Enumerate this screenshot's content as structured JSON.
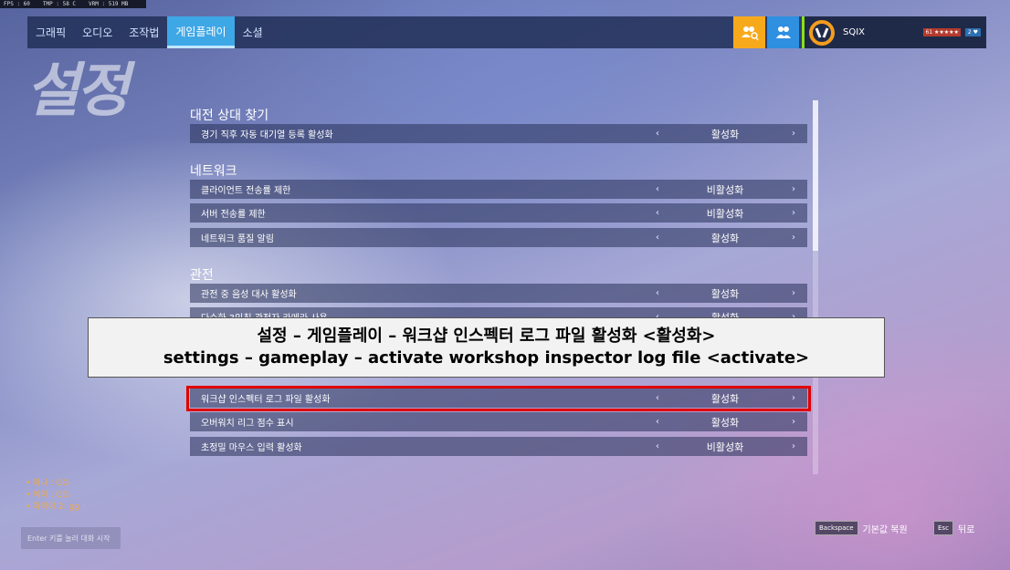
{
  "perf": {
    "fps": "FPS : 60",
    "tmp": "TMP : 58 C",
    "vram": "VRM : 519 MB"
  },
  "tabs": [
    {
      "label": "그래픽"
    },
    {
      "label": "오디오"
    },
    {
      "label": "조작법"
    },
    {
      "label": "게임플레이",
      "active": true
    },
    {
      "label": "소셜"
    }
  ],
  "profile": {
    "name": "SQIX",
    "level": "61 ★★★★★",
    "endorsement": "2 ♥"
  },
  "page_title": "설정",
  "sections": [
    {
      "heading": "대전 상대 찾기",
      "rows": [
        {
          "label": "경기 직후 자동 대기열 등록 활성화",
          "value": "활성화"
        }
      ]
    },
    {
      "heading": "네트워크",
      "rows": [
        {
          "label": "클라이언트 전송률 제한",
          "value": "비활성화"
        },
        {
          "label": "서버 전송률 제한",
          "value": "비활성화"
        },
        {
          "label": "네트워크 품질 알림",
          "value": "활성화"
        }
      ]
    },
    {
      "heading": "관전",
      "rows": [
        {
          "label": "관전 중 음성 대사 활성화",
          "value": "활성화"
        },
        {
          "label": "다수화 3인칭 관전자 카메라 사용",
          "value": "활성화"
        }
      ]
    },
    {
      "heading": "",
      "rows": [
        {
          "label": "워크샵 인스펙터 로그 파일 활성화",
          "value": "활성화"
        },
        {
          "label": "오버워치 리그 점수 표시",
          "value": "활성화"
        },
        {
          "label": "초정밀 마우스 입력 활성화",
          "value": "비활성화"
        }
      ]
    }
  ],
  "caption": {
    "line1": "설정 – 게임플레이 – 워크샵 인스펙터 로그 파일 활성화 <활성화>",
    "line2": "settings – gameplay – activate workshop inspector log file <activate>"
  },
  "chat": {
    "lines": [
      "• 아나 : GG",
      "• 메이 : GG",
      "• 자리야 2: gg !"
    ],
    "placeholder": "Enter 키를 눌러 대화 시작"
  },
  "footer": {
    "reset_key": "Backspace",
    "reset_label": "기본값 복원",
    "back_key": "Esc",
    "back_label": "뒤로"
  },
  "arrows": {
    "left": "‹",
    "right": "›"
  },
  "colors": {
    "active_tab": "#3ea7e6",
    "highlight": "#e00000",
    "social_orange": "#f7a91c"
  }
}
